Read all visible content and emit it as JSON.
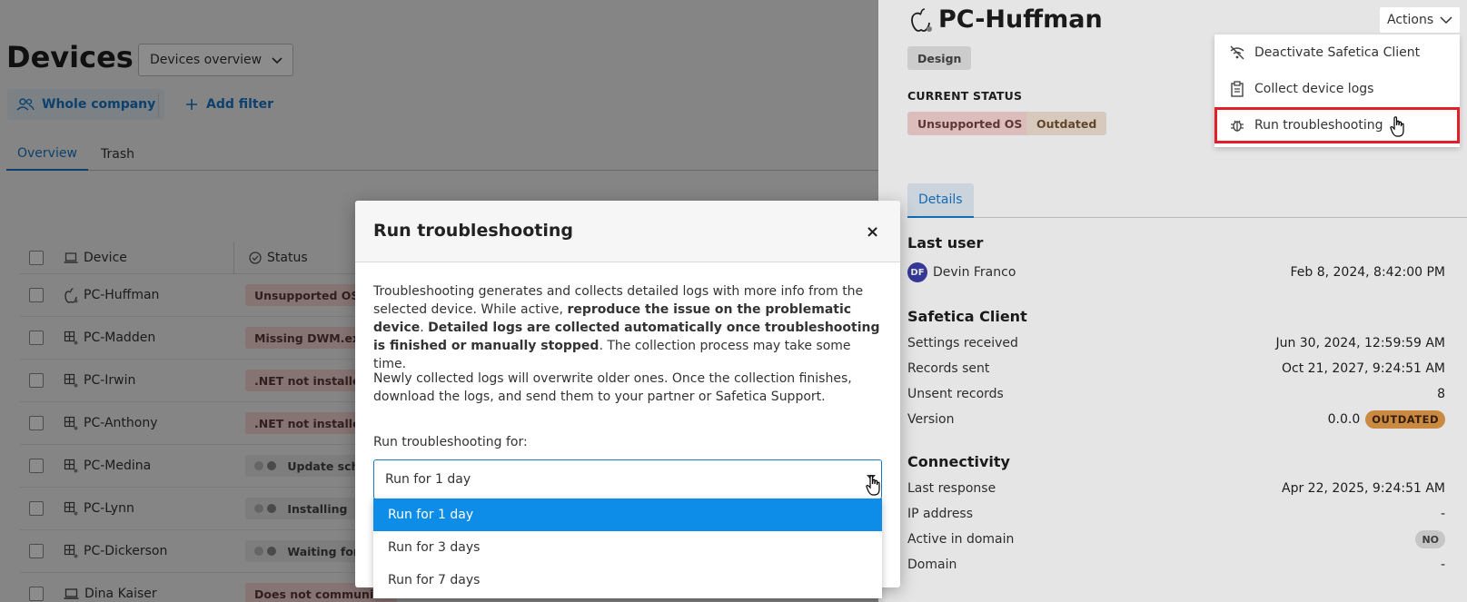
{
  "left": {
    "title": "Devices",
    "view_dropdown": "Devices overview",
    "filter_whole_company": "Whole company",
    "filter_add": "Add filter",
    "tabs": [
      "Overview",
      "Trash"
    ],
    "columns": {
      "device": "Device",
      "status": "Status"
    },
    "rows": [
      {
        "name": "PC-Huffman",
        "os": "apple",
        "status": "Unsupported OS",
        "kind": "red"
      },
      {
        "name": "PC-Madden",
        "os": "windows",
        "status": "Missing DWM.exe",
        "kind": "red"
      },
      {
        "name": "PC-Irwin",
        "os": "windows",
        "status": ".NET not installed",
        "kind": "red"
      },
      {
        "name": "PC-Anthony",
        "os": "windows",
        "status": ".NET not installed",
        "kind": "red"
      },
      {
        "name": "PC-Medina",
        "os": "windows",
        "status": "Update sche",
        "kind": "grey"
      },
      {
        "name": "PC-Lynn",
        "os": "windows",
        "status": "Installing",
        "kind": "grey"
      },
      {
        "name": "PC-Dickerson",
        "os": "windows",
        "status": "Waiting for",
        "kind": "grey"
      },
      {
        "name": "Dina Kaiser",
        "os": "laptop",
        "status": "Does not communica",
        "kind": "red"
      }
    ]
  },
  "panel": {
    "device_name": "PC-Huffman",
    "tag": "Design",
    "actions_label": "Actions",
    "actions_menu": [
      "Deactivate Safetica Client",
      "Collect device logs",
      "Run troubleshooting"
    ],
    "current_status_label": "CURRENT STATUS",
    "statuses": [
      "Unsupported OS",
      "Outdated"
    ],
    "tab_details": "Details",
    "last_user": {
      "heading": "Last user",
      "initials": "DF",
      "name": "Devin Franco",
      "date": "Feb 8, 2024, 8:42:00 PM"
    },
    "client": {
      "heading": "Safetica Client",
      "settings_received_label": "Settings received",
      "settings_received": "Jun 30, 2024, 12:59:59 AM",
      "records_sent_label": "Records sent",
      "records_sent": "Oct 21, 2027, 9:24:51 AM",
      "unsent_label": "Unsent records",
      "unsent": "8",
      "version_label": "Version",
      "version": "0.0.0",
      "version_badge": "OUTDATED"
    },
    "connectivity": {
      "heading": "Connectivity",
      "last_response_label": "Last response",
      "last_response": "Apr 22, 2025, 9:24:51 AM",
      "ip_label": "IP address",
      "ip": "-",
      "active_domain_label": "Active in domain",
      "active_domain": "NO",
      "domain_label": "Domain",
      "domain": "-"
    }
  },
  "modal": {
    "title": "Run troubleshooting",
    "close": "×",
    "p1_a": "Troubleshooting generates and collects detailed logs with more info from the selected device. While active, ",
    "p1_b": "reproduce the issue on the problematic device",
    "p1_c": ". ",
    "p1_d": "Detailed logs are collected automatically once troubleshooting is finished or manually stopped",
    "p1_e": ". The collection process may take some time.",
    "p2": "Newly collected logs will overwrite older ones. Once the collection finishes, download the logs, and send them to your partner or Safetica Support.",
    "select_label": "Run troubleshooting for:",
    "select_value": "Run for 1 day",
    "options": [
      "Run for 1 day",
      "Run for 3 days",
      "Run for 7 days"
    ]
  },
  "colors": {
    "accent": "#1976c7",
    "selected_option": "#0d8ce8",
    "highlight_outline": "#e0202a",
    "status_red": "#f4d4d2",
    "outdated_badge": "#e39a4a"
  }
}
